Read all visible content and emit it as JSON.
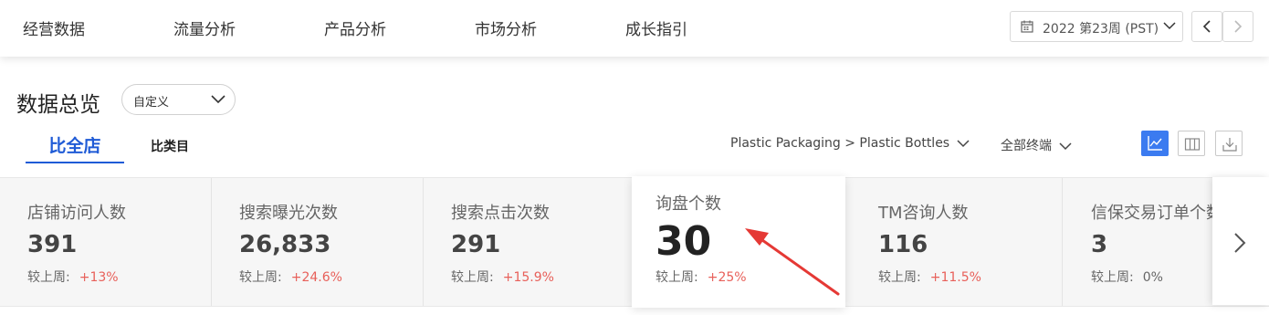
{
  "nav": {
    "items": [
      "经营数据",
      "流量分析",
      "产品分析",
      "市场分析",
      "成长指引"
    ]
  },
  "date_selector": {
    "value": "2022 第23周 (PST)",
    "icon": "calendar-icon"
  },
  "pager": {
    "prev_icon": "chevron-left-icon",
    "next_icon": "chevron-right-icon"
  },
  "overview": {
    "title": "数据总览",
    "range_select": "自定义",
    "tabs": {
      "active": "比全店",
      "other": "比类目"
    },
    "category_filter": "Plastic Packaging > Plastic Bottles",
    "terminal_filter": "全部终端",
    "tools": [
      "line-chart-icon",
      "columns-icon",
      "download-icon"
    ]
  },
  "metrics": [
    {
      "label": "店铺访问人数",
      "value": "391",
      "compare_label": "较上周:",
      "change": "+13%"
    },
    {
      "label": "搜索曝光次数",
      "value": "26,833",
      "compare_label": "较上周:",
      "change": "+24.6%"
    },
    {
      "label": "搜索点击次数",
      "value": "291",
      "compare_label": "较上周:",
      "change": "+15.9%"
    },
    {
      "label": "询盘个数",
      "value": "30",
      "compare_label": "较上周:",
      "change": "+25%"
    },
    {
      "label": "TM咨询人数",
      "value": "116",
      "compare_label": "较上周:",
      "change": "+11.5%"
    },
    {
      "label": "信保交易订单个数",
      "value": "3",
      "compare_label": "较上周:",
      "change": "0%"
    }
  ],
  "colors": {
    "accent": "#1f5bd6",
    "positive": "#e8605a",
    "annotation": "#e53935"
  }
}
